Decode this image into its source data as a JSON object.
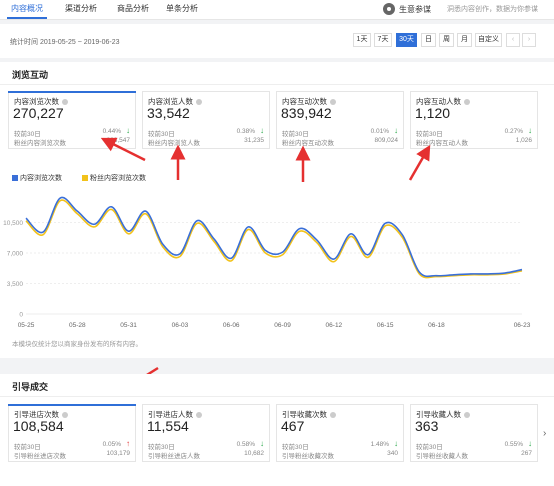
{
  "nav": {
    "tabs": [
      "内容概况",
      "渠道分析",
      "商品分析",
      "单条分析"
    ],
    "active_tab": 0,
    "right_link": "生意参谋",
    "right_hint": "洞悉内容创作，数据为你参谋"
  },
  "date_bar": {
    "range_label": "统计时间 2019-05-25 ~ 2019-06-23",
    "buttons": [
      "1天",
      "7天",
      "30天",
      "日",
      "周",
      "月",
      "自定义"
    ],
    "active_button": 2,
    "prev_icon": "chevron-left-icon",
    "next_icon": "chevron-right-icon"
  },
  "browse": {
    "title": "浏览互动",
    "cards": [
      {
        "label": "内容浏览次数",
        "value": "270,227",
        "cmp_label": "较前30日",
        "pct": "0.44%",
        "trend": "down",
        "fans_label": "粉丝内容浏览次数",
        "fans_value": "263,547"
      },
      {
        "label": "内容浏览人数",
        "value": "33,542",
        "cmp_label": "较前30日",
        "pct": "0.38%",
        "trend": "down",
        "fans_label": "粉丝内容浏览人数",
        "fans_value": "31,235"
      },
      {
        "label": "内容互动次数",
        "value": "839,942",
        "cmp_label": "较前30日",
        "pct": "0.01%",
        "trend": "down",
        "fans_label": "粉丝内容互动次数",
        "fans_value": "809,024"
      },
      {
        "label": "内容互动人数",
        "value": "1,120",
        "cmp_label": "较前30日",
        "pct": "0.27%",
        "trend": "down",
        "fans_label": "粉丝内容互动人数",
        "fans_value": "1,026"
      }
    ],
    "note": "本模块仅统计您以商家身份发布的所有内容。"
  },
  "guide": {
    "title": "引导成交",
    "cards": [
      {
        "label": "引导进店次数",
        "value": "108,584",
        "cmp_label": "较前30日",
        "pct": "0.05%",
        "trend": "up",
        "fans_label": "引导粉丝进店次数",
        "fans_value": "103,179"
      },
      {
        "label": "引导进店人数",
        "value": "11,554",
        "cmp_label": "较前30日",
        "pct": "0.58%",
        "trend": "down",
        "fans_label": "引导粉丝进店人数",
        "fans_value": "10,682"
      },
      {
        "label": "引导收藏次数",
        "value": "467",
        "cmp_label": "较前30日",
        "pct": "1.48%",
        "trend": "down",
        "fans_label": "引导粉丝收藏次数",
        "fans_value": "340"
      },
      {
        "label": "引导收藏人数",
        "value": "363",
        "cmp_label": "较前30日",
        "pct": "0.55%",
        "trend": "down",
        "fans_label": "引导粉丝收藏人数",
        "fans_value": "267"
      }
    ],
    "next_icon": "chevron-right-icon"
  },
  "colors": {
    "accent": "#2f6fd8",
    "series1": "#3a6fd8",
    "series2": "#f2c21b",
    "annotation": "#e53030",
    "up": "#e23b3b",
    "down": "#2aa84a"
  },
  "chart_data": {
    "type": "line",
    "x": [
      "05-25",
      "05-26",
      "05-27",
      "05-28",
      "05-29",
      "05-30",
      "05-31",
      "06-01",
      "06-02",
      "06-03",
      "06-04",
      "06-05",
      "06-06",
      "06-07",
      "06-08",
      "06-09",
      "06-10",
      "06-11",
      "06-12",
      "06-13",
      "06-14",
      "06-15",
      "06-16",
      "06-17",
      "06-18",
      "06-19",
      "06-20",
      "06-21",
      "06-22",
      "06-23"
    ],
    "xticks": [
      "05-25",
      "05-28",
      "05-31",
      "06-03",
      "06-06",
      "06-09",
      "06-12",
      "06-15",
      "06-18",
      "06-23"
    ],
    "yticks": [
      "0",
      "3,500",
      "7,000",
      "10,500"
    ],
    "ylim": [
      0,
      14000
    ],
    "series": [
      {
        "name": "内容浏览次数",
        "values": [
          11000,
          9400,
          13300,
          11800,
          10300,
          12300,
          9500,
          11800,
          8000,
          6900,
          10700,
          8600,
          6400,
          10000,
          7300,
          7100,
          9800,
          8500,
          6300,
          9200,
          6800,
          10400,
          9100,
          4800,
          4400,
          4500,
          4600,
          4600,
          4700,
          5100
        ]
      },
      {
        "name": "粉丝内容浏览次数",
        "values": [
          10700,
          9100,
          13000,
          11500,
          10000,
          12000,
          9200,
          11500,
          7700,
          6600,
          10400,
          8300,
          6100,
          9700,
          7000,
          6800,
          9500,
          8200,
          6000,
          8900,
          6500,
          10100,
          8800,
          4600,
          4300,
          4400,
          4500,
          4500,
          4600,
          4950
        ]
      }
    ]
  }
}
